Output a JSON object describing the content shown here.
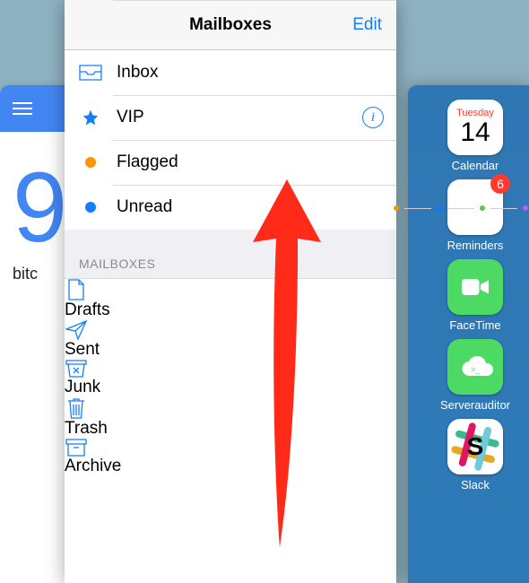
{
  "left_card": {
    "big_number": "9",
    "caption": "bitc"
  },
  "mail": {
    "title": "Mailboxes",
    "edit_label": "Edit",
    "favorites": [
      {
        "icon": "inbox-icon",
        "label": "Inbox",
        "info": false
      },
      {
        "icon": "star-icon",
        "label": "VIP",
        "info": true
      },
      {
        "icon": "flag-dot",
        "label": "Flagged",
        "info": false,
        "dot": "orange"
      },
      {
        "icon": "unread-dot",
        "label": "Unread",
        "info": false,
        "dot": "blue"
      }
    ],
    "group_label": "MAILBOXES",
    "boxes": [
      {
        "icon": "drafts-icon",
        "label": "Drafts"
      },
      {
        "icon": "sent-icon",
        "label": "Sent"
      },
      {
        "icon": "junk-icon",
        "label": "Junk"
      },
      {
        "icon": "trash-icon",
        "label": "Trash"
      },
      {
        "icon": "archive-icon",
        "label": "Archive"
      }
    ]
  },
  "slideover": {
    "calendar": {
      "day_name": "Tuesday",
      "day_number": "14",
      "app_name": "Calendar"
    },
    "reminders": {
      "badge": "6",
      "app_name": "Reminders"
    },
    "facetime": {
      "app_name": "FaceTime"
    },
    "serverauditor": {
      "app_name": "Serverauditor"
    },
    "slack": {
      "letter": "S",
      "app_name": "Slack"
    }
  }
}
